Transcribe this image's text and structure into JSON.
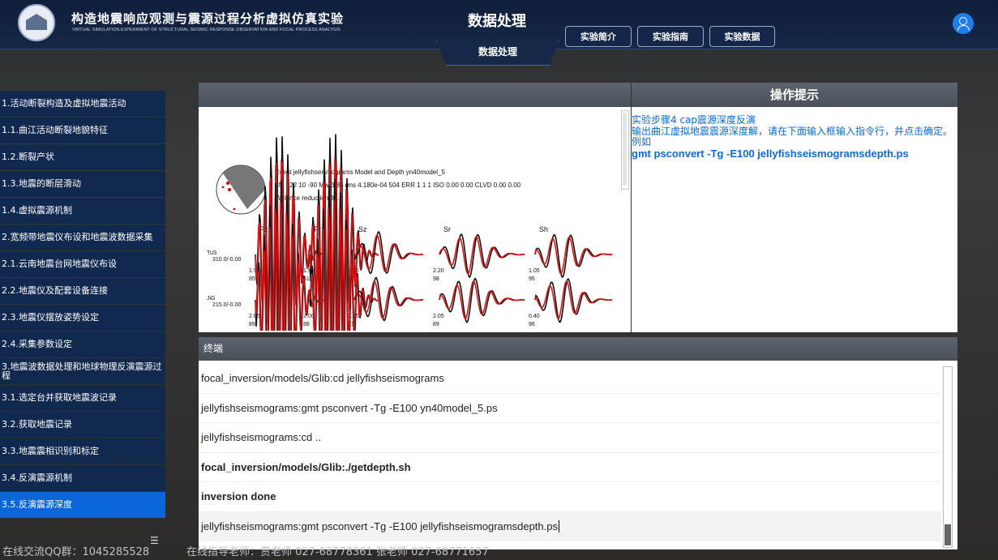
{
  "header": {
    "title": "构造地震响应观测与震源过程分析虚拟仿真实验",
    "subtitle": "VIRTUAL SIMULATION EXPERIMENT OF STRUCTURAL SEISMIC RESPONSE OBSERVATION AND FOCAL PROCESS ANALYSIS",
    "page_title": "数据处理",
    "active_tab": "数据处理",
    "buttons": [
      "实验简介",
      "实验指南",
      "实验数据"
    ]
  },
  "sidebar": {
    "items": [
      {
        "label": "1.活动断裂构造及虚拟地震活动",
        "active": false
      },
      {
        "label": "1.1.曲江活动断裂地貌特征",
        "active": false
      },
      {
        "label": "1.2.断裂产状",
        "active": false
      },
      {
        "label": "1.3.地震的断层滑动",
        "active": false
      },
      {
        "label": "1.4.虚拟震源机制",
        "active": false
      },
      {
        "label": "2.宽频带地震仪布设和地震波数据采集",
        "active": false
      },
      {
        "label": "2.1.云南地震台网地震仪布设",
        "active": false
      },
      {
        "label": "2.2.地震仪及配套设备连接",
        "active": false
      },
      {
        "label": "2.3.地震仪摆放姿势设定",
        "active": false
      },
      {
        "label": "2.4.采集参数设定",
        "active": false
      },
      {
        "label": "3.地震波数据处理和地球物理反演震源过程",
        "active": false
      },
      {
        "label": "3.1.选定台并获取地震波记录",
        "active": false
      },
      {
        "label": "3.2.获取地震记录",
        "active": false
      },
      {
        "label": "3.3.地震震相识别和标定",
        "active": false
      },
      {
        "label": "3.4.反演震源机制",
        "active": false
      },
      {
        "label": "3.5.反演震源深度",
        "active": true
      }
    ]
  },
  "plot": {
    "line1": "Event jellyfishseismograms Model and Depth yn40model_5",
    "line2": "FM 122 10 -90 Mw 3.86 rms 4.180e-04 504 ERR 1 1 1 ISO 0.00 0.00 CLVD 0.00 0.00",
    "line3": "Variance reduction 84.2",
    "components": [
      "Pz",
      "Pr",
      "Sz",
      "Sr",
      "Sh"
    ],
    "stations": [
      {
        "name": "TuS",
        "info": "310.0/-0.00",
        "values": [
          [
            "1.95",
            "85"
          ],
          [
            "1.95",
            "81"
          ],
          [
            "2.20",
            "87"
          ],
          [
            "2.20",
            "98"
          ],
          [
            "1.05",
            "95"
          ]
        ]
      },
      {
        "name": "JiG",
        "info": "215.0/-0.00",
        "values": [
          [
            "2.05",
            "89"
          ],
          [
            "2.00",
            "88"
          ],
          [
            "2.05",
            "91"
          ],
          [
            "2.05",
            "89"
          ],
          [
            "0.40",
            "96"
          ]
        ]
      }
    ]
  },
  "tips": {
    "title": "操作提示",
    "step": "实验步骤4  cap震源深度反演",
    "desc": "输出曲江虚拟地震震源深度解，请在下面输入框输入指令行，并点击确定。",
    "example_label": "例如",
    "example_cmd": "gmt psconvert -Tg -E100 jellyfishseismogramsdepth.ps"
  },
  "terminal": {
    "title": "终端",
    "lines": [
      {
        "text": "focal_inversion/models/Glib:cd jellyfishseismograms",
        "bold": false
      },
      {
        "text": "jellyfishseismograms:gmt psconvert -Tg -E100 yn40model_5.ps",
        "bold": false
      },
      {
        "text": "jellyfishseismograms:cd ..",
        "bold": false
      },
      {
        "text": "focal_inversion/models/Glib:./getdepth.sh",
        "bold": true
      },
      {
        "text": "inversion  done",
        "bold": true
      }
    ],
    "input_value": "jellyfishseismograms:gmt psconvert -Tg -E100 jellyfishseismogramsdepth.ps"
  },
  "footer": {
    "qq": "在线交流QQ群：1045285528",
    "teachers": "在线指导老师：贾老师 027-68778361   张老师 027-68771657"
  },
  "colors": {
    "accent": "#0b66d9",
    "sidebar": "#12294f",
    "tips_text": "#0b6be0"
  }
}
